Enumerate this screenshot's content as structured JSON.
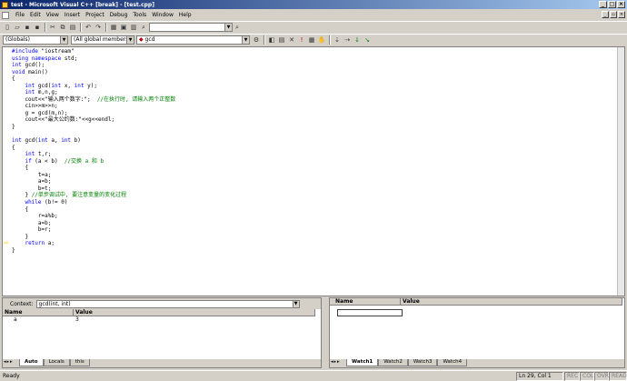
{
  "window": {
    "title": "test - Microsoft Visual C++ [break] - [test.cpp]"
  },
  "menu": [
    "File",
    "Edit",
    "View",
    "Insert",
    "Project",
    "Debug",
    "Tools",
    "Window",
    "Help"
  ],
  "wizard": {
    "class": "(Globals)",
    "filter": "(All global members",
    "member": "gcd"
  },
  "code_lines": [
    {
      "text": "#include \"iostream\"",
      "type": "kw"
    },
    {
      "text": "using namespace std;",
      "type": "kw"
    },
    {
      "text": "int gcd();",
      "type": "normal"
    },
    {
      "text": "void main()",
      "type": "normal"
    },
    {
      "text": "{",
      "type": "normal"
    },
    {
      "text": "    int gcd(int x, int y);",
      "type": "normal"
    },
    {
      "text": "    int m,n,g;",
      "type": "normal"
    },
    {
      "text": "    cout<<\"输入两个数字:\";  //在执行时, 请输入两个正整数",
      "type": "mixed"
    },
    {
      "text": "    cin>>m>>n;",
      "type": "normal"
    },
    {
      "text": "    g = gcd(m,n);",
      "type": "normal"
    },
    {
      "text": "    cout<<\"最大公约数:\"<<g<<endl;",
      "type": "normal"
    },
    {
      "text": "}",
      "type": "normal"
    },
    {
      "text": "",
      "type": "normal"
    },
    {
      "text": "int gcd(int a, int b)",
      "type": "normal"
    },
    {
      "text": "{",
      "type": "normal"
    },
    {
      "text": "    int t,r;",
      "type": "normal"
    },
    {
      "text": "    if (a < b)  //交换 a 和 b",
      "type": "mixed"
    },
    {
      "text": "    {",
      "type": "normal"
    },
    {
      "text": "        t=a;",
      "type": "normal"
    },
    {
      "text": "        a=b;",
      "type": "normal"
    },
    {
      "text": "        b=t;",
      "type": "normal"
    },
    {
      "text": "    } //单步调试中, 要注意变量的变化过程",
      "type": "mixed"
    },
    {
      "text": "    while (b!= 0)",
      "type": "normal"
    },
    {
      "text": "    {",
      "type": "normal"
    },
    {
      "text": "        r=a%b;",
      "type": "normal"
    },
    {
      "text": "        a=b;",
      "type": "normal"
    },
    {
      "text": "        b=r;",
      "type": "normal"
    },
    {
      "text": "    }",
      "type": "normal"
    },
    {
      "text": "    return a;",
      "type": "normal"
    },
    {
      "text": "}",
      "type": "normal"
    }
  ],
  "current_line_index": 28,
  "variables": {
    "context_label": "Context:",
    "context_value": "gcd(int, int)",
    "headers": [
      "Name",
      "Value"
    ],
    "rows": [
      {
        "name": "a",
        "value": "3"
      }
    ],
    "tabs": [
      "Auto",
      "Locals",
      "this"
    ]
  },
  "watch": {
    "headers": [
      "Name",
      "Value"
    ],
    "tabs": [
      "Watch1",
      "Watch2",
      "Watch3",
      "Watch4"
    ]
  },
  "status": {
    "left": "Ready",
    "position": "Ln 29, Col 1",
    "indicators": [
      "REC",
      "COL",
      "OVR",
      "READ"
    ]
  }
}
